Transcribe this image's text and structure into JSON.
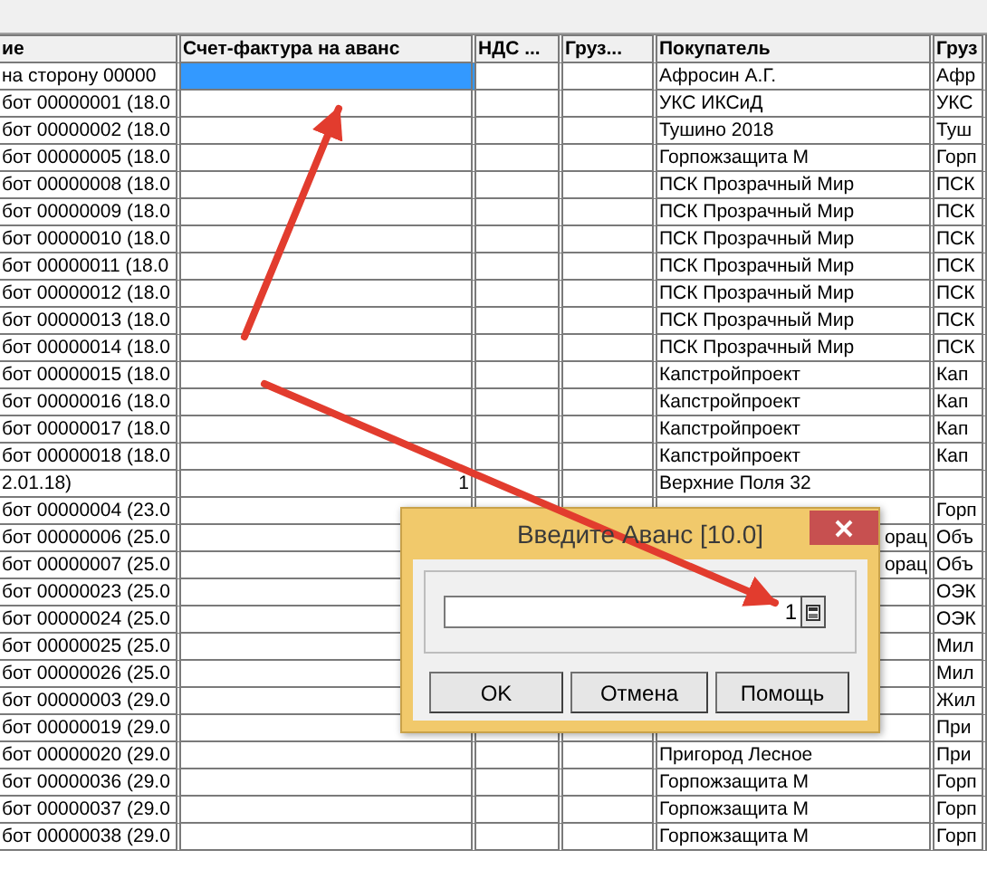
{
  "table": {
    "columns": [
      "ие",
      "Счет-фактура на аванс",
      "НДС ...",
      "Груз...",
      "Покупатель",
      "Груз"
    ],
    "rows": [
      {
        "selected": true,
        "column_1": "на сторону 00000",
        "buyer": "Афросин А.Г.",
        "column_6": "Афр"
      },
      {
        "selected": false,
        "column_1": "бот 00000001 (18.0",
        "buyer": "УКС ИКСиД",
        "column_6": "УКС"
      },
      {
        "selected": false,
        "column_1": "бот 00000002 (18.0",
        "buyer": "Тушино 2018",
        "column_6": "Туш"
      },
      {
        "selected": false,
        "column_1": "бот 00000005 (18.0",
        "buyer": "Горпожзащита М",
        "column_6": "Горп"
      },
      {
        "selected": false,
        "column_1": "бот 00000008 (18.0",
        "buyer": "ПСК Прозрачный Мир",
        "column_6": "ПСК"
      },
      {
        "selected": false,
        "column_1": "бот 00000009 (18.0",
        "buyer": "ПСК Прозрачный Мир",
        "column_6": "ПСК"
      },
      {
        "selected": false,
        "column_1": "бот 00000010 (18.0",
        "buyer": "ПСК Прозрачный Мир",
        "column_6": "ПСК"
      },
      {
        "selected": false,
        "column_1": "бот 00000011 (18.0",
        "buyer": "ПСК Прозрачный Мир",
        "column_6": "ПСК"
      },
      {
        "selected": false,
        "column_1": "бот 00000012 (18.0",
        "buyer": "ПСК Прозрачный Мир",
        "column_6": "ПСК"
      },
      {
        "selected": false,
        "column_1": "бот 00000013 (18.0",
        "buyer": "ПСК Прозрачный Мир",
        "column_6": "ПСК"
      },
      {
        "selected": false,
        "column_1": "бот 00000014 (18.0",
        "buyer": "ПСК Прозрачный Мир",
        "column_6": "ПСК"
      },
      {
        "selected": false,
        "column_1": "бот 00000015 (18.0",
        "buyer": "Капстройпроект",
        "column_6": "Кап"
      },
      {
        "selected": false,
        "column_1": "бот 00000016 (18.0",
        "buyer": "Капстройпроект",
        "column_6": "Кап"
      },
      {
        "selected": false,
        "column_1": "бот 00000017 (18.0",
        "buyer": "Капстройпроект",
        "column_6": "Кап"
      },
      {
        "selected": false,
        "column_1": "бот 00000018 (18.0",
        "buyer": "Капстройпроект",
        "column_6": "Кап"
      },
      {
        "selected": false,
        "column_1": "2.01.18)",
        "invoice": "1",
        "buyer": "Верхние Поля 32"
      },
      {
        "selected": false,
        "column_1": "бот 00000004 (23.0",
        "column_6": "Горп"
      },
      {
        "selected": false,
        "column_1": "бот 00000006 (25.0",
        "buyer_tail": "орац",
        "column_6": "Объ"
      },
      {
        "selected": false,
        "column_1": "бот 00000007 (25.0",
        "buyer_tail": "орац",
        "column_6": "Объ"
      },
      {
        "selected": false,
        "column_1": "бот 00000023 (25.0",
        "column_6": "ОЭК"
      },
      {
        "selected": false,
        "column_1": "бот 00000024 (25.0",
        "column_6": "ОЭК"
      },
      {
        "selected": false,
        "column_1": "бот 00000025 (25.0",
        "column_6": "Мил"
      },
      {
        "selected": false,
        "column_1": "бот 00000026 (25.0",
        "column_6": "Мил"
      },
      {
        "selected": false,
        "column_1": "бот 00000003 (29.0",
        "column_6": "Жил"
      },
      {
        "selected": false,
        "column_1": "бот 00000019 (29.0",
        "column_6": "При"
      },
      {
        "selected": false,
        "column_1": "бот 00000020 (29.0",
        "buyer": "Пригород Лесное",
        "column_6": "При"
      },
      {
        "selected": false,
        "column_1": "бот 00000036 (29.0",
        "buyer": "Горпожзащита М",
        "column_6": "Горп"
      },
      {
        "selected": false,
        "column_1": "бот 00000037 (29.0",
        "buyer": "Горпожзащита М",
        "column_6": "Горп"
      },
      {
        "selected": false,
        "column_1": "бот 00000038 (29.0",
        "buyer": "Горпожзащита М",
        "column_6": "Горп"
      }
    ]
  },
  "dialog": {
    "title": "Введите Аванс [10.0]",
    "value": "1",
    "buttons": [
      "OK",
      "Отмена",
      "Помощь"
    ]
  }
}
